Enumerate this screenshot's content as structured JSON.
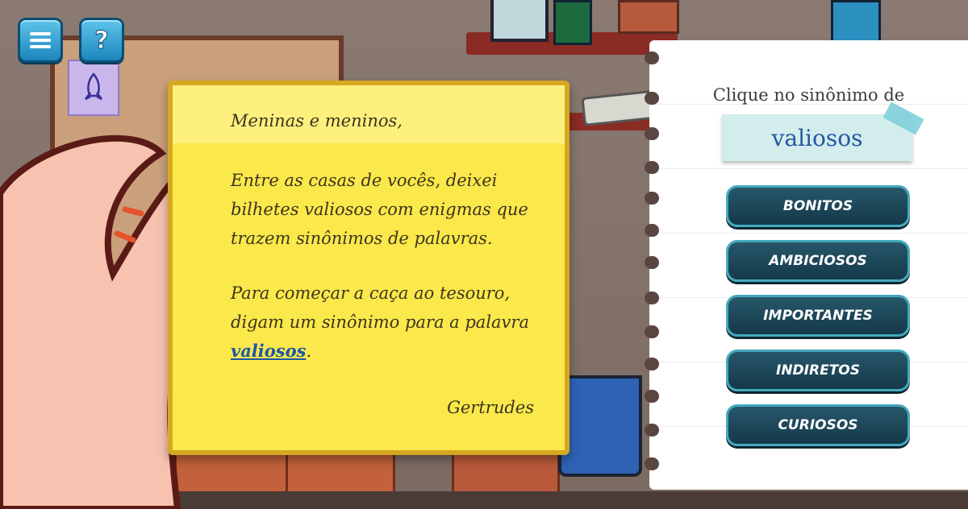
{
  "hud": {
    "menu_icon": "hamburger-menu-icon",
    "help_label": "?"
  },
  "note": {
    "greeting": "Meninas e meninos,",
    "paragraph1": "Entre as casas de vocês, deixei bilhetes valiosos com enigmas que trazem sinônimos de palavras.",
    "paragraph2_prefix": "Para começar a caça ao tesouro, digam um sinônimo para a palavra ",
    "paragraph2_link": "valiosos",
    "paragraph2_suffix": ".",
    "signature": "Gertrudes"
  },
  "panel": {
    "prompt": "Clique no sinônimo de",
    "target_word": "valiosos",
    "options": [
      "BONITOS",
      "AMBICIOSOS",
      "IMPORTANTES",
      "INDIRETOS",
      "CURIOSOS"
    ]
  },
  "colors": {
    "note_yellow": "#fbe84a",
    "button_teal": "#44a8bd",
    "word_blue": "#2157a3"
  }
}
